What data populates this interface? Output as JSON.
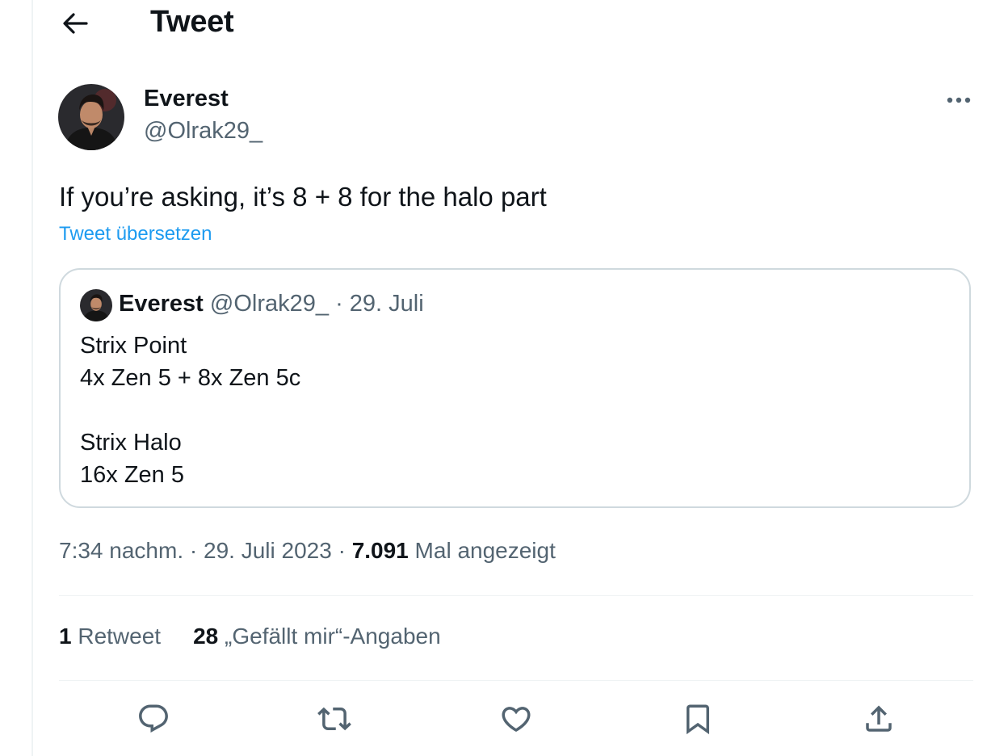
{
  "header": {
    "title": "Tweet",
    "back_icon": "arrow-left-icon"
  },
  "tweet": {
    "author": {
      "name": "Everest",
      "handle": "@Olrak29_"
    },
    "text": "If you’re asking, it’s 8 + 8 for the halo part",
    "translate_label": "Tweet übersetzen",
    "quoted": {
      "author_name": "Everest",
      "author_handle": "@Olrak29_",
      "separator": "·",
      "date": "29. Juli",
      "lines": [
        "Strix Point",
        "4x Zen 5 + 8x Zen 5c",
        "",
        "Strix Halo",
        "16x Zen 5"
      ]
    },
    "time": "7:34 nachm.",
    "separator": "·",
    "date": "29. Juli 2023",
    "views_count": "7.091",
    "views_label": "Mal angezeigt",
    "stats": {
      "retweets_count": "1",
      "retweets_label": "Retweet",
      "likes_count": "28",
      "likes_label": "„Gefällt mir“-Angaben"
    }
  },
  "actions": [
    {
      "name": "reply-icon"
    },
    {
      "name": "retweet-icon"
    },
    {
      "name": "like-icon"
    },
    {
      "name": "bookmark-icon"
    },
    {
      "name": "share-icon"
    }
  ],
  "colors": {
    "accent": "#1d9bf0",
    "text_primary": "#0f1419",
    "text_secondary": "#536471",
    "border": "#cfd9de"
  }
}
